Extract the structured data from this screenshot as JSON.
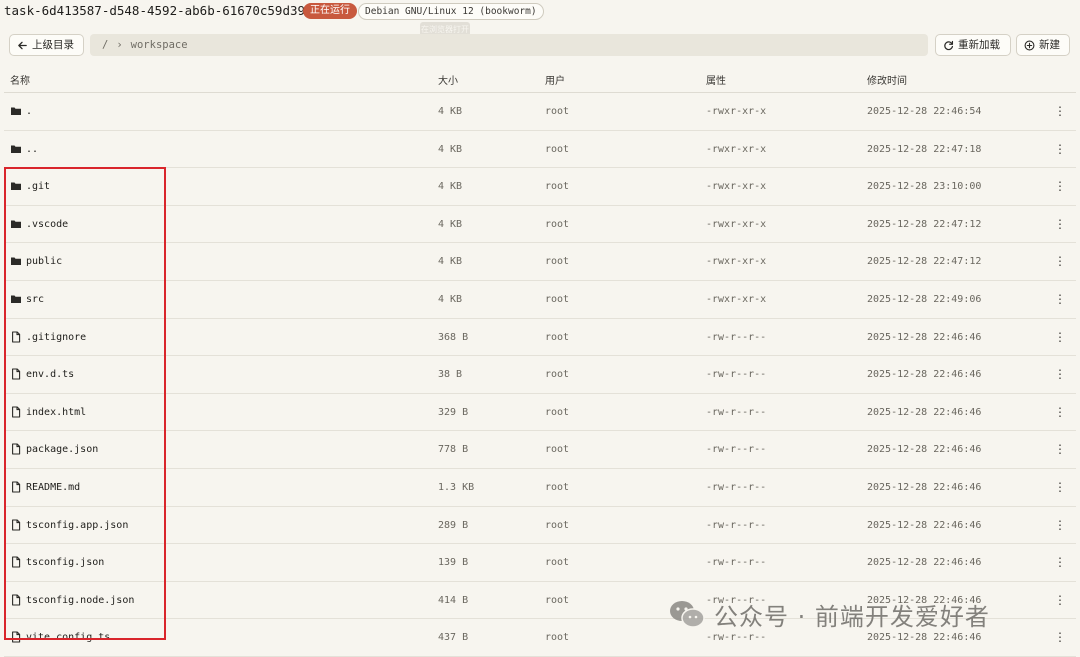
{
  "header": {
    "task_title": "task-6d413587-d548-4592-ab6b-61670c59d396",
    "status_badge": "正在运行",
    "os_badge": "Debian GNU/Linux 12 (bookworm)",
    "tooltip": "在浏览器打开"
  },
  "toolbar": {
    "back_label": "上级目录",
    "path_root": "/",
    "path_separator": "›",
    "path_segment": "workspace",
    "reload_label": "重新加载",
    "new_label": "新建"
  },
  "table": {
    "columns": [
      "名称",
      "大小",
      "用户",
      "属性",
      "修改时间"
    ],
    "rows": [
      {
        "type": "folder",
        "name": ".",
        "size": "4 KB",
        "user": "root",
        "perm": "-rwxr-xr-x",
        "time": "2025-12-28 22:46:54"
      },
      {
        "type": "folder",
        "name": "..",
        "size": "4 KB",
        "user": "root",
        "perm": "-rwxr-xr-x",
        "time": "2025-12-28 22:47:18"
      },
      {
        "type": "folder",
        "name": ".git",
        "size": "4 KB",
        "user": "root",
        "perm": "-rwxr-xr-x",
        "time": "2025-12-28 23:10:00"
      },
      {
        "type": "folder",
        "name": ".vscode",
        "size": "4 KB",
        "user": "root",
        "perm": "-rwxr-xr-x",
        "time": "2025-12-28 22:47:12"
      },
      {
        "type": "folder",
        "name": "public",
        "size": "4 KB",
        "user": "root",
        "perm": "-rwxr-xr-x",
        "time": "2025-12-28 22:47:12"
      },
      {
        "type": "folder",
        "name": "src",
        "size": "4 KB",
        "user": "root",
        "perm": "-rwxr-xr-x",
        "time": "2025-12-28 22:49:06"
      },
      {
        "type": "file",
        "name": ".gitignore",
        "size": "368 B",
        "user": "root",
        "perm": "-rw-r--r--",
        "time": "2025-12-28 22:46:46"
      },
      {
        "type": "file",
        "name": "env.d.ts",
        "size": "38 B",
        "user": "root",
        "perm": "-rw-r--r--",
        "time": "2025-12-28 22:46:46"
      },
      {
        "type": "file",
        "name": "index.html",
        "size": "329 B",
        "user": "root",
        "perm": "-rw-r--r--",
        "time": "2025-12-28 22:46:46"
      },
      {
        "type": "file",
        "name": "package.json",
        "size": "778 B",
        "user": "root",
        "perm": "-rw-r--r--",
        "time": "2025-12-28 22:46:46"
      },
      {
        "type": "file",
        "name": "README.md",
        "size": "1.3 KB",
        "user": "root",
        "perm": "-rw-r--r--",
        "time": "2025-12-28 22:46:46"
      },
      {
        "type": "file",
        "name": "tsconfig.app.json",
        "size": "289 B",
        "user": "root",
        "perm": "-rw-r--r--",
        "time": "2025-12-28 22:46:46"
      },
      {
        "type": "file",
        "name": "tsconfig.json",
        "size": "139 B",
        "user": "root",
        "perm": "-rw-r--r--",
        "time": "2025-12-28 22:46:46"
      },
      {
        "type": "file",
        "name": "tsconfig.node.json",
        "size": "414 B",
        "user": "root",
        "perm": "-rw-r--r--",
        "time": "2025-12-28 22:46:46"
      },
      {
        "type": "file",
        "name": "vite.config.ts",
        "size": "437 B",
        "user": "root",
        "perm": "-rw-r--r--",
        "time": "2025-12-28 22:46:46"
      }
    ]
  },
  "watermark": {
    "text": "公众号 · 前端开发爱好者",
    "icon": "wechat-icon"
  },
  "colors": {
    "background": "#f7f5ef",
    "status_badge": "#c8593e",
    "highlight": "#d9252b"
  }
}
